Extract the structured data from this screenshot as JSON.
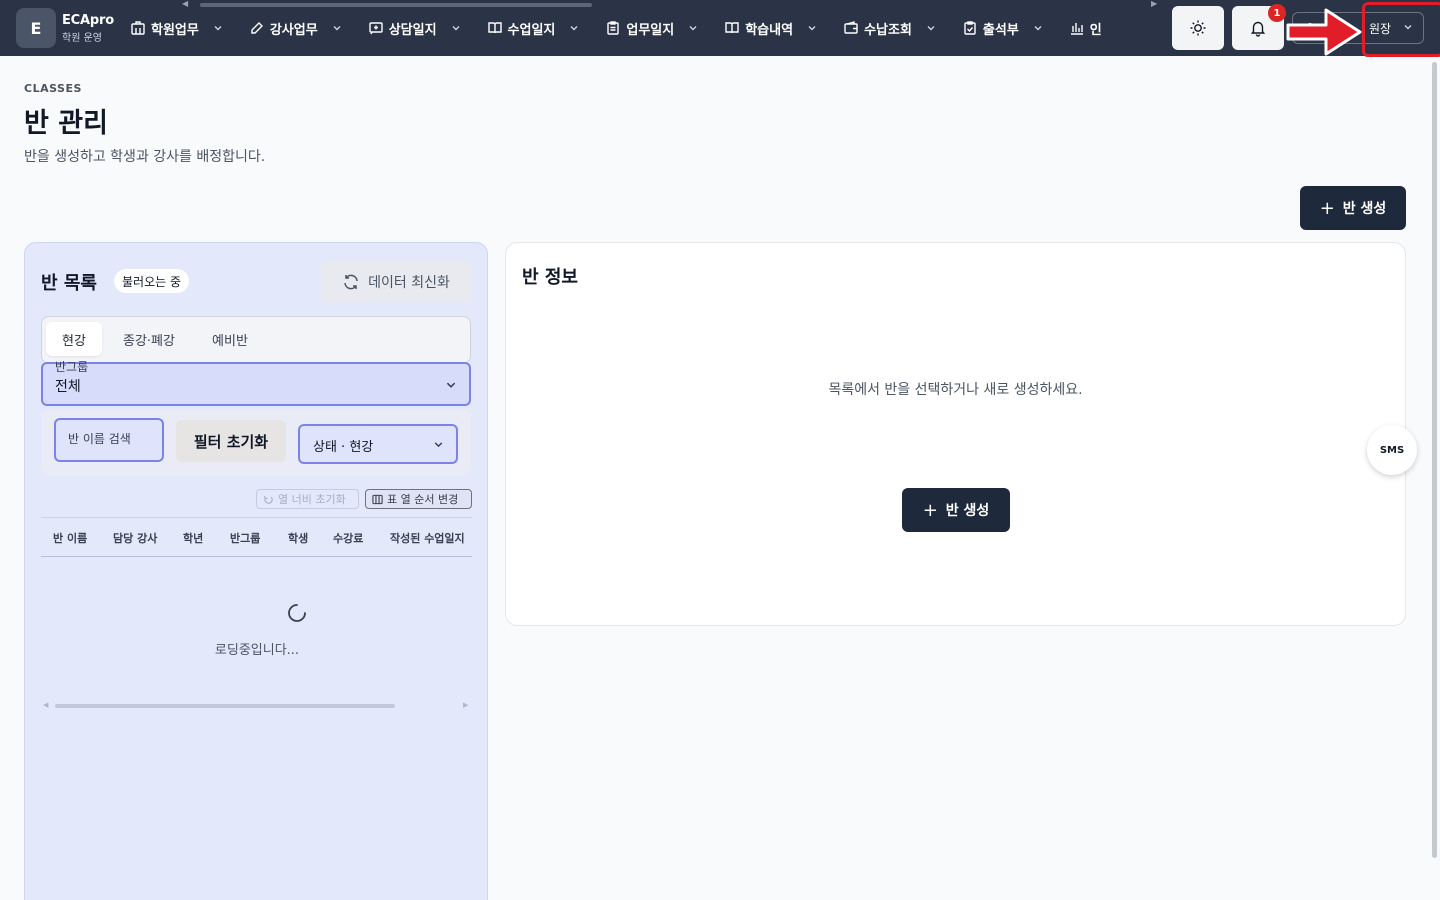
{
  "app": {
    "logo_letter": "E",
    "name": "ECApro",
    "subtitle": "학원 운영"
  },
  "nav": [
    {
      "label": "학원업무",
      "icon": "building-icon"
    },
    {
      "label": "강사업무",
      "icon": "edit-icon"
    },
    {
      "label": "상담일지",
      "icon": "message-plus-icon"
    },
    {
      "label": "수업일지",
      "icon": "book-open-icon"
    },
    {
      "label": "업무일지",
      "icon": "clipboard-icon"
    },
    {
      "label": "학습내역",
      "icon": "book-open-icon"
    },
    {
      "label": "수납조회",
      "icon": "wallet-icon"
    },
    {
      "label": "출석부",
      "icon": "clipboard-check-icon"
    },
    {
      "label": "인",
      "icon": "bar-chart-icon"
    }
  ],
  "header_actions": {
    "theme_icon": "sun-icon",
    "bell_icon": "bell-icon",
    "notification_count": "1",
    "user_label": "원장"
  },
  "page": {
    "eyebrow": "CLASSES",
    "title": "반 관리",
    "description": "반을 생성하고 학생과 강사를 배정합니다.",
    "create_button": "반 생성"
  },
  "list_panel": {
    "title": "반 목록",
    "loading_chip": "불러오는 중",
    "refresh_button": "데이터 최신화",
    "tabs": [
      {
        "label": "현강",
        "active": true
      },
      {
        "label": "종강·폐강",
        "active": false
      },
      {
        "label": "예비반",
        "active": false
      }
    ],
    "group_select": {
      "label": "반그룹",
      "value": "전체"
    },
    "search_placeholder": "반 이름 검색",
    "reset_button": "필터 초기화",
    "status_select": "상태 · 현강",
    "reset_width_button": "열 너비 초기화",
    "column_order_button": "표 열 순서 변경",
    "columns": [
      "반 이름",
      "담당 강사",
      "학년",
      "반그룹",
      "학생",
      "수강료",
      "작성된 수업일지"
    ],
    "loading_text": "로딩중입니다..."
  },
  "detail_panel": {
    "title": "반 정보",
    "empty_message": "목록에서 반을 선택하거나 새로 생성하세요.",
    "create_button": "반 생성"
  },
  "floating": {
    "sms_label": "SMS"
  },
  "colors": {
    "topbar": "#2b3446",
    "primary_button": "#1e293b",
    "accent_border": "#7b82e8",
    "panel_bg": "#e3e8fb",
    "annotation_red": "#e11d2a",
    "badge": "#dc2626"
  }
}
